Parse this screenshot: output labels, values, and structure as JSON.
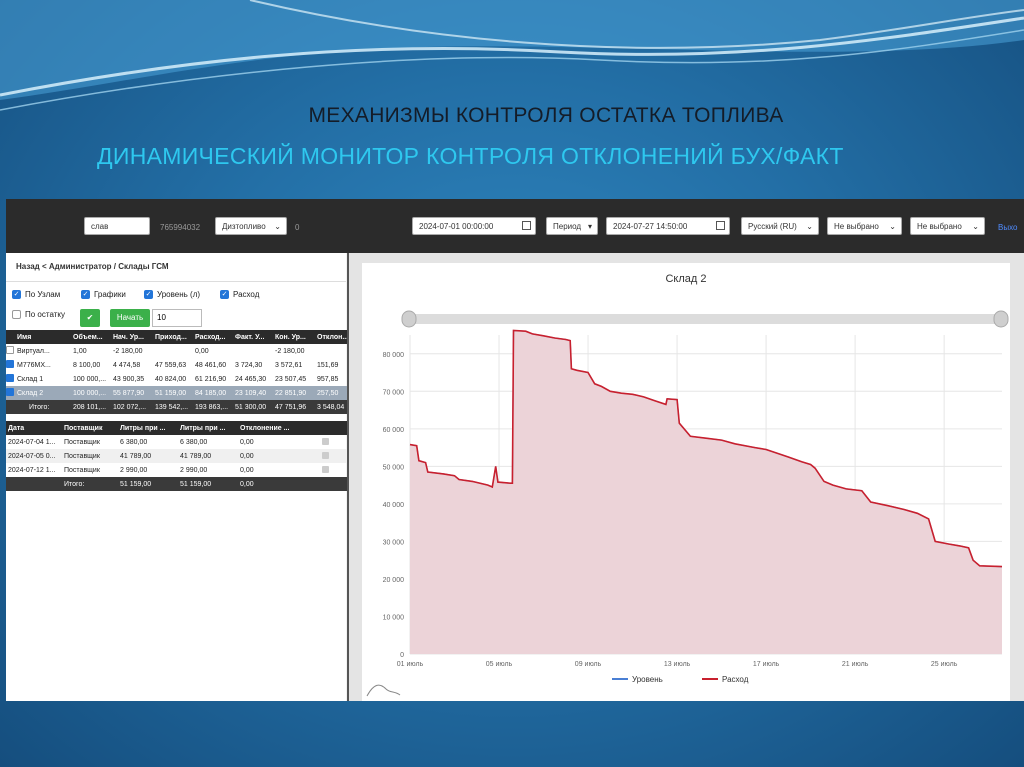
{
  "slide": {
    "title": "МЕХАНИЗМЫ КОНТРОЛЯ ОСТАТКА ТОПЛИВА",
    "subtitle": "ДИНАМИЧЕСКИЙ МОНИТОР КОНТРОЛЯ ОТКЛОНЕНИЙ БУХ/ФАКТ"
  },
  "topbar": {
    "search_value": "слав",
    "id_text": "765994032",
    "fuel_type": "Дизтопливо",
    "count": "0",
    "date_from": "2024-07-01 00:00:00",
    "period_label": "Период",
    "date_to": "2024-07-27 14:50:00",
    "language": "Русский (RU)",
    "select1": "Не выбрано",
    "select2": "Не выбрано",
    "exit_label": "Выхо"
  },
  "panel": {
    "breadcrumb": "Назад < Администратор / Склады ГСМ",
    "checks": [
      {
        "label": "По Узлам",
        "checked": true
      },
      {
        "label": "Графики",
        "checked": true
      },
      {
        "label": "Уровень (л)",
        "checked": true
      },
      {
        "label": "Расход",
        "checked": true
      },
      {
        "label": "По остатку",
        "checked": false
      }
    ],
    "ok_icon": "✔",
    "start_label": "Начать",
    "start_value": "10"
  },
  "table1": {
    "headers": [
      "",
      "Имя",
      "Объем...",
      "Нач. Ур...",
      "Приход...",
      "Расход...",
      "Факт. У...",
      "Кон. Ур...",
      "Отклон..."
    ],
    "rows": [
      {
        "checked": false,
        "cells": [
          "Виртуал...",
          "1,00",
          "-2 180,00",
          "",
          "0,00",
          "",
          "-2 180,00",
          ""
        ]
      },
      {
        "checked": true,
        "cells": [
          "М776МХ...",
          "8 100,00",
          "4 474,58",
          "47 559,63",
          "48 461,60",
          "3 724,30",
          "3 572,61",
          "151,69"
        ]
      },
      {
        "checked": true,
        "cells": [
          "Склад 1",
          "100 000,...",
          "43 900,35",
          "40 824,00",
          "61 216,90",
          "24 465,30",
          "23 507,45",
          "957,85"
        ]
      },
      {
        "checked": true,
        "cells": [
          "Склад 2",
          "100 000,...",
          "55 877,90",
          "51 159,00",
          "84 185,00",
          "23 109,40",
          "22 851,90",
          "257,50"
        ]
      }
    ],
    "total": [
      "Итого:",
      "208 101,...",
      "102 072,...",
      "139 542,...",
      "193 863,...",
      "51 300,00",
      "47 751,96",
      "3 548,04"
    ]
  },
  "table2": {
    "headers": [
      "Дата",
      "Поставщик",
      "Литры при ...",
      "Литры при ...",
      "Отклонение ...",
      ""
    ],
    "rows": [
      [
        "2024-07-04 1...",
        "Поставщик",
        "6 380,00",
        "6 380,00",
        "0,00"
      ],
      [
        "2024-07-05 0...",
        "Поставщик",
        "41 789,00",
        "41 789,00",
        "0,00"
      ],
      [
        "2024-07-12 1...",
        "Поставщик",
        "2 990,00",
        "2 990,00",
        "0,00"
      ]
    ],
    "total": [
      "Итого:",
      "51 159,00",
      "51 159,00",
      "0,00"
    ]
  },
  "chart_data": {
    "type": "area",
    "title": "Склад 2",
    "x_ticks": [
      "01 июль",
      "05 июль",
      "09 июль",
      "13 июль",
      "17 июль",
      "21 июль",
      "25 июль"
    ],
    "y_ticks": [
      "0",
      "10 000",
      "20 000",
      "30 000",
      "40 000",
      "50 000",
      "60 000",
      "70 000",
      "80 000"
    ],
    "xlim": [
      1,
      27.6
    ],
    "ylim": [
      0,
      85000
    ],
    "legend_position": "bottom",
    "colors": {
      "level": "#4a7fd4",
      "consumption": "#c8202e",
      "fill": "#ecd3d8"
    },
    "series": [
      {
        "name": "Уровень",
        "points": [
          [
            1.0,
            55800
          ],
          [
            1.3,
            55500
          ],
          [
            1.4,
            51500
          ],
          [
            1.7,
            51000
          ],
          [
            1.8,
            48500
          ],
          [
            2.5,
            48000
          ],
          [
            3.0,
            47500
          ],
          [
            3.2,
            46500
          ],
          [
            3.8,
            46000
          ],
          [
            4.5,
            45000
          ],
          [
            4.7,
            44500
          ],
          [
            4.85,
            50000
          ],
          [
            4.95,
            45800
          ],
          [
            5.5,
            45500
          ],
          [
            5.6,
            45500
          ],
          [
            5.65,
            86200
          ],
          [
            6.2,
            86000
          ],
          [
            6.5,
            85300
          ],
          [
            7.0,
            84800
          ],
          [
            7.5,
            84200
          ],
          [
            8.0,
            83800
          ],
          [
            8.2,
            83500
          ],
          [
            8.25,
            76000
          ],
          [
            8.5,
            75600
          ],
          [
            9.0,
            75000
          ],
          [
            9.3,
            72000
          ],
          [
            9.6,
            71300
          ],
          [
            10.0,
            70000
          ],
          [
            10.5,
            69500
          ],
          [
            11.0,
            69200
          ],
          [
            11.5,
            68500
          ],
          [
            12.0,
            67500
          ],
          [
            12.5,
            66500
          ],
          [
            12.55,
            68000
          ],
          [
            13.0,
            67800
          ],
          [
            13.1,
            61500
          ],
          [
            13.6,
            58000
          ],
          [
            14.3,
            57500
          ],
          [
            15.0,
            57000
          ],
          [
            15.6,
            56000
          ],
          [
            16.5,
            55000
          ],
          [
            17.0,
            54500
          ],
          [
            17.5,
            53500
          ],
          [
            18.0,
            52500
          ],
          [
            18.6,
            51200
          ],
          [
            19.0,
            50500
          ],
          [
            19.2,
            49500
          ],
          [
            19.6,
            46000
          ],
          [
            20.0,
            45000
          ],
          [
            20.6,
            44000
          ],
          [
            21.3,
            43500
          ],
          [
            21.7,
            40500
          ],
          [
            22.5,
            39500
          ],
          [
            23.2,
            38500
          ],
          [
            23.8,
            37500
          ],
          [
            24.3,
            36000
          ],
          [
            24.6,
            30000
          ],
          [
            25.2,
            29300
          ],
          [
            25.7,
            28800
          ],
          [
            26.1,
            28300
          ],
          [
            26.3,
            25000
          ],
          [
            26.6,
            23500
          ],
          [
            27.6,
            23300
          ]
        ]
      },
      {
        "name": "Расход",
        "points": [
          [
            1.0,
            55800
          ],
          [
            1.3,
            55500
          ],
          [
            1.4,
            51500
          ],
          [
            1.7,
            51000
          ],
          [
            1.8,
            48500
          ],
          [
            2.5,
            48000
          ],
          [
            3.0,
            47500
          ],
          [
            3.2,
            46500
          ],
          [
            3.8,
            46000
          ],
          [
            4.5,
            45000
          ],
          [
            4.7,
            44500
          ],
          [
            4.85,
            50000
          ],
          [
            4.95,
            45800
          ],
          [
            5.5,
            45500
          ],
          [
            5.6,
            45500
          ],
          [
            5.65,
            86200
          ],
          [
            6.2,
            86000
          ],
          [
            6.5,
            85300
          ],
          [
            7.0,
            84800
          ],
          [
            7.5,
            84200
          ],
          [
            8.0,
            83800
          ],
          [
            8.2,
            83500
          ],
          [
            8.25,
            76000
          ],
          [
            8.5,
            75600
          ],
          [
            9.0,
            75000
          ],
          [
            9.3,
            72000
          ],
          [
            9.6,
            71300
          ],
          [
            10.0,
            70000
          ],
          [
            10.5,
            69500
          ],
          [
            11.0,
            69200
          ],
          [
            11.5,
            68500
          ],
          [
            12.0,
            67500
          ],
          [
            12.5,
            66500
          ],
          [
            12.55,
            68000
          ],
          [
            13.0,
            67800
          ],
          [
            13.1,
            61500
          ],
          [
            13.6,
            58000
          ],
          [
            14.3,
            57500
          ],
          [
            15.0,
            57000
          ],
          [
            15.6,
            56000
          ],
          [
            16.5,
            55000
          ],
          [
            17.0,
            54500
          ],
          [
            17.5,
            53500
          ],
          [
            18.0,
            52500
          ],
          [
            18.6,
            51200
          ],
          [
            19.0,
            50500
          ],
          [
            19.2,
            49500
          ],
          [
            19.6,
            46000
          ],
          [
            20.0,
            45000
          ],
          [
            20.6,
            44000
          ],
          [
            21.3,
            43500
          ],
          [
            21.7,
            40500
          ],
          [
            22.5,
            39500
          ],
          [
            23.2,
            38500
          ],
          [
            23.8,
            37500
          ],
          [
            24.3,
            36000
          ],
          [
            24.6,
            30000
          ],
          [
            25.2,
            29300
          ],
          [
            25.7,
            28800
          ],
          [
            26.1,
            28300
          ],
          [
            26.3,
            25000
          ],
          [
            26.6,
            23500
          ],
          [
            27.6,
            23300
          ]
        ]
      }
    ]
  }
}
